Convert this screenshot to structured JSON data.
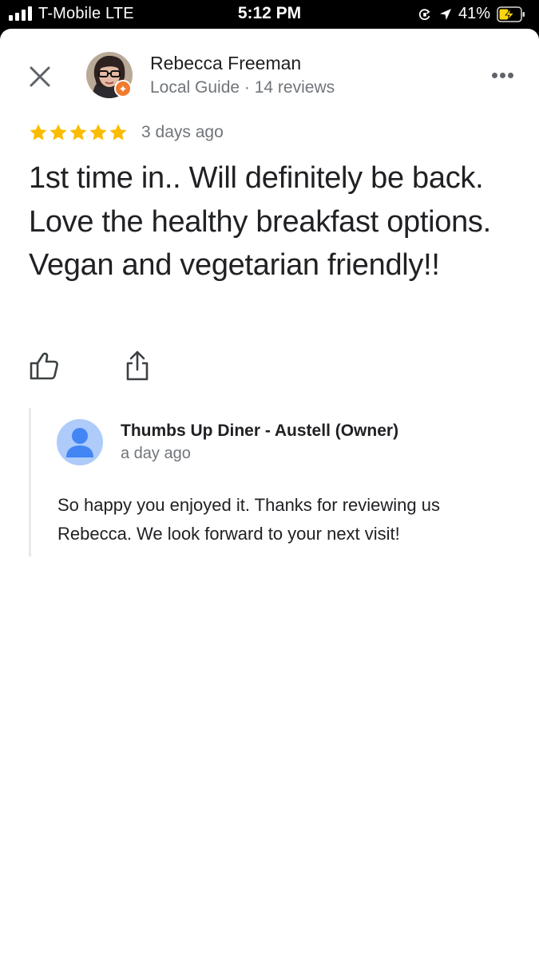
{
  "status_bar": {
    "carrier": "T-Mobile  LTE",
    "time": "5:12 PM",
    "battery": "41%"
  },
  "reviewer": {
    "name": "Rebecca Freeman",
    "meta": "Local Guide · 14 reviews"
  },
  "review": {
    "rating": 5,
    "date": "3 days ago",
    "text": "1st time in.. Will definitely be back. Love the healthy breakfast options. Vegan and vegetarian friendly!!"
  },
  "owner_reply": {
    "name": "Thumbs Up Diner - Austell (Owner)",
    "date": "a day ago",
    "text": "So happy you enjoyed it.  Thanks for reviewing us Rebecca.  We look forward to your next visit!"
  },
  "icons": {
    "close": "close-icon",
    "more": "more-horizontal-icon",
    "like": "thumbs-up-icon",
    "share": "share-icon",
    "star": "star-icon"
  },
  "colors": {
    "star": "#fbbc04",
    "guide_badge": "#f07a2e",
    "owner_avatar_bg": "#aecbfa",
    "owner_avatar_fg": "#4285f4"
  }
}
